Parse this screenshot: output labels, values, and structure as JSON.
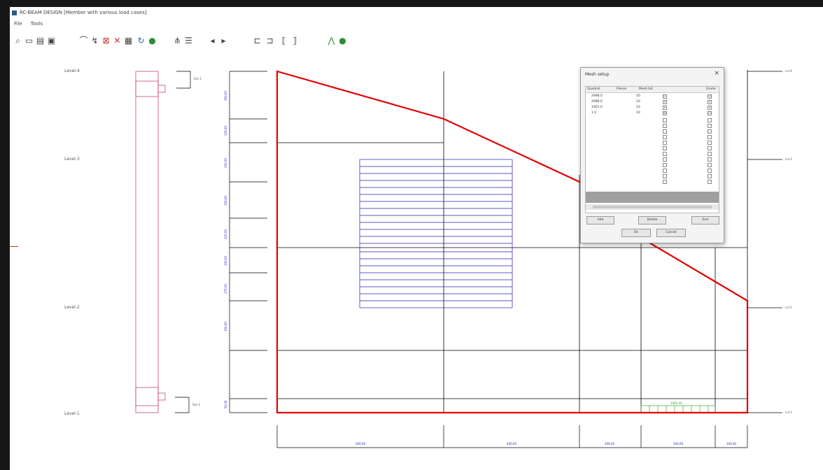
{
  "window": {
    "title": "RC-BEAM DESIGN [Member with various load cases]",
    "status": ""
  },
  "menu": [
    "File",
    "Tools"
  ],
  "toolbar": {
    "icons": [
      "zoom-icon",
      "open-icon",
      "new-icon",
      "save-icon",
      "beam-icon",
      "load-icon",
      "section-icon",
      "delete-icon",
      "table-icon",
      "refresh-icon",
      "run-icon",
      "member-icon",
      "list-icon",
      "prev-icon",
      "next-icon",
      "rebar-icon",
      "bracket-left-icon",
      "bracket-right-icon",
      "stirrup-icon",
      "chart-icon",
      "check-icon"
    ]
  },
  "drawing": {
    "level_labels": [
      "Level-4",
      "Level-3",
      "Level-2",
      "Level-1"
    ],
    "right_labels": [
      "Lvl-4",
      "Lvl-3",
      "Lvl-2",
      "Lvl-1"
    ],
    "section_tags": [
      "Sec-1",
      "Sec-2"
    ],
    "span_labels": [
      "500.00",
      "400.00",
      "200.00",
      "200.00",
      "100.00"
    ],
    "vertical_labels": [
      "350.00",
      "125.00",
      "100.00",
      "150.00",
      "225.00",
      "150.00",
      "375.00",
      "100.00",
      "50.00"
    ],
    "small_box_label": "1000.00",
    "colors": {
      "outline": "#e00000",
      "grid": "#000000",
      "hatch": "#2222bb",
      "dims": "#2222cc",
      "green": "#33aa33",
      "pink": "#cc4466"
    }
  },
  "dialog": {
    "title": "Mesh setup",
    "close": "×",
    "columns": [
      "Quadrat",
      "Pieces",
      "Mesh tot",
      "Grade"
    ],
    "rows": [
      {
        "quadrat": "2998.0",
        "pieces": "10",
        "mesh": "☐",
        "grade": "☐"
      },
      {
        "quadrat": "2986.0",
        "pieces": "10",
        "mesh": "✔",
        "grade": "✔"
      },
      {
        "quadrat": "1001.0",
        "pieces": "10",
        "mesh": "✔",
        "grade": "✔"
      },
      {
        "quadrat": "1.0",
        "pieces": "10",
        "mesh": "☒",
        "grade": "☐"
      }
    ],
    "empty_rows": 12,
    "buttons": {
      "add": "Add",
      "delete": "Delete",
      "sort": "Sort",
      "ok": "Ok",
      "cancel": "Cancel"
    }
  }
}
